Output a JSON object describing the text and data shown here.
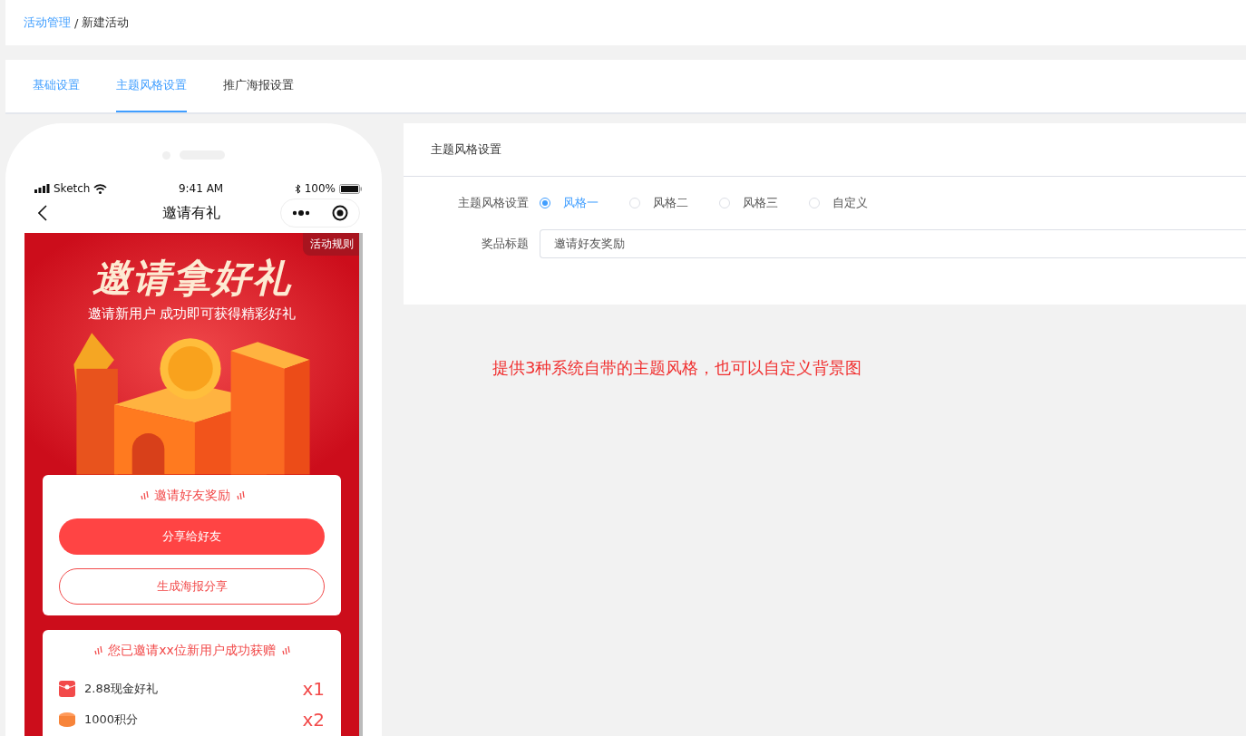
{
  "breadcrumb": [
    {
      "label": "活动管理",
      "link": true
    },
    {
      "label": "新建活动",
      "link": false
    }
  ],
  "breadcrumb_separator": "/",
  "tabs": [
    {
      "label": "基础设置",
      "selected": false,
      "visited": true
    },
    {
      "label": "主题风格设置",
      "selected": true,
      "visited": true
    },
    {
      "label": "推广海报设置",
      "selected": false,
      "visited": false
    }
  ],
  "phone": {
    "status_bar": {
      "carrier": "Sketch",
      "time": "9:41 AM",
      "battery": "100%"
    },
    "nav_title": "邀请有礼",
    "rules_badge": "活动规则",
    "hero": {
      "title": "邀请拿好礼",
      "subtitle": "邀请新用户 成功即可获得精彩好礼"
    },
    "reward_card": {
      "title": "邀请好友奖励",
      "buttons": [
        {
          "label": "分享给好友",
          "kind": "filled"
        },
        {
          "label": "生成海报分享",
          "kind": "outline"
        }
      ]
    },
    "invite_card": {
      "title": "您已邀请xx位新用户成功获赠",
      "items": [
        {
          "name": "2.88现金好礼",
          "count": "x1",
          "kind": "redpacket"
        },
        {
          "name": "1000积分",
          "count": "x2",
          "kind": "coin"
        }
      ]
    }
  },
  "settings_panel": {
    "title": "主题风格设置",
    "style_field": {
      "label": "主题风格设置",
      "options": [
        {
          "label": "风格一",
          "selected": true
        },
        {
          "label": "风格二",
          "selected": false
        },
        {
          "label": "风格三",
          "selected": false
        },
        {
          "label": "自定义",
          "selected": false
        }
      ]
    },
    "prize_title_field": {
      "label": "奖品标题",
      "value": "邀请好友奖励"
    }
  },
  "note": "提供3种系统自带的主题风格，也可以自定义背景图"
}
